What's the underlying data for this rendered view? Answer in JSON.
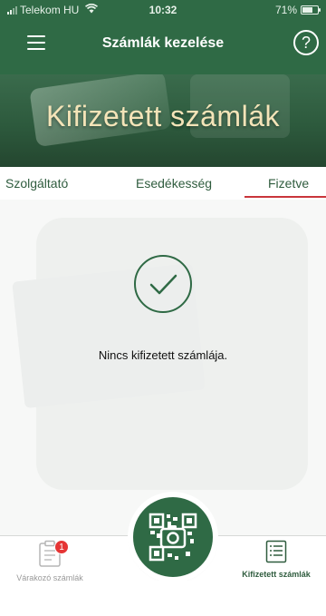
{
  "status_bar": {
    "carrier": "Telekom HU",
    "time": "10:32",
    "battery": "71%",
    "battery_level": 0.71
  },
  "header": {
    "title": "Számlák kezelése",
    "menu_icon": "hamburger-menu-icon",
    "help_icon": "question-circle-icon",
    "help_glyph": "?"
  },
  "hero": {
    "title": "Kifizetett számlák"
  },
  "tabs": [
    {
      "label": "Szolgáltató",
      "selected": false
    },
    {
      "label": "Esedékesség",
      "selected": false
    },
    {
      "label": "Fizetve",
      "selected": true
    }
  ],
  "content": {
    "empty_message": "Nincs kifizetett számlája.",
    "icon": "checkmark-circle-icon"
  },
  "bottom_nav": {
    "pending": {
      "label": "Várakozó számlák",
      "badge": "1",
      "icon": "clipboard-icon"
    },
    "scan": {
      "icon": "qr-camera-icon"
    },
    "paid": {
      "label": "Kifizetett számlák",
      "icon": "paid-list-icon"
    }
  },
  "colors": {
    "primary_green": "#2f6a45",
    "hero_text": "#f4e4b8",
    "tab_indicator": "#c9353b",
    "badge_red": "#e53535"
  }
}
